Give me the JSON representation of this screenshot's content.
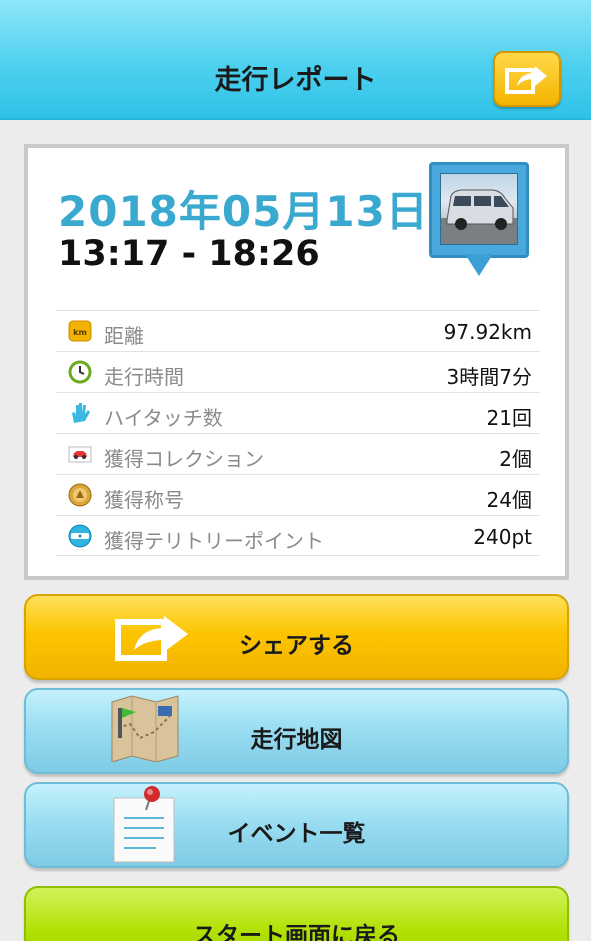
{
  "header": {
    "title": "走行レポート",
    "share_icon": "share-arrow-icon"
  },
  "report": {
    "date": "2018年05月13日",
    "time_range": "13:17 - 18:26",
    "photo": "car-photo"
  },
  "stats": [
    {
      "icon": "km-icon",
      "label": "距離",
      "value": "97.92km"
    },
    {
      "icon": "clock-icon",
      "label": "走行時間",
      "value": "3時間7分"
    },
    {
      "icon": "hi-touch-icon",
      "label": "ハイタッチ数",
      "value": "21回"
    },
    {
      "icon": "car-card-icon",
      "label": "獲得コレクション",
      "value": "2個"
    },
    {
      "icon": "title-medal-icon",
      "label": "獲得称号",
      "value": "24個"
    },
    {
      "icon": "spot-icon",
      "label": "獲得テリトリーポイント",
      "value": "240pt"
    }
  ],
  "buttons": {
    "share": "シェアする",
    "map": "走行地図",
    "events": "イベント一覧",
    "start": "スタート画面に戻る"
  },
  "colors": {
    "header": "#4ed0ef",
    "date": "#3aa9cf",
    "share_button": "#fcc500",
    "nav_button": "#97dcf1",
    "start_button": "#b0e000"
  }
}
